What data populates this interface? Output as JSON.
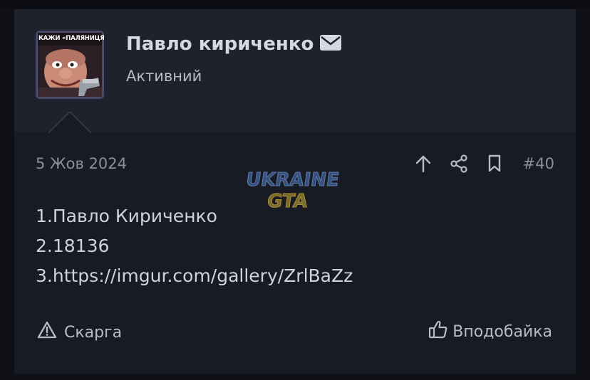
{
  "post": {
    "author": {
      "name": "Павло кириченко",
      "status": "Активний",
      "avatar_caption": "КАЖИ «ПАЛЯНИЦЯ»",
      "message_icon": "envelope-icon"
    },
    "date": "5 Жов 2024",
    "number": "#40",
    "actions": {
      "upvote_icon": "arrow-up-icon",
      "share_icon": "share-icon",
      "bookmark_icon": "bookmark-icon"
    },
    "watermark": {
      "line1": "UKRAINE",
      "line2": "GTA"
    },
    "body_lines": [
      "1.Павло Кириченко",
      "2.18136",
      "3.https://imgur.com/gallery/ZrlBaZz"
    ],
    "footer": {
      "report_label": "Скарга",
      "report_icon": "warning-icon",
      "like_label": "Вподобайка",
      "like_icon": "thumbs-up-icon"
    }
  },
  "colors": {
    "page_bg": "#0f1016",
    "post_bg": "#191b24",
    "header_bg": "#1f212c",
    "text": "#b9bcc6",
    "muted": "#8b8e99"
  }
}
